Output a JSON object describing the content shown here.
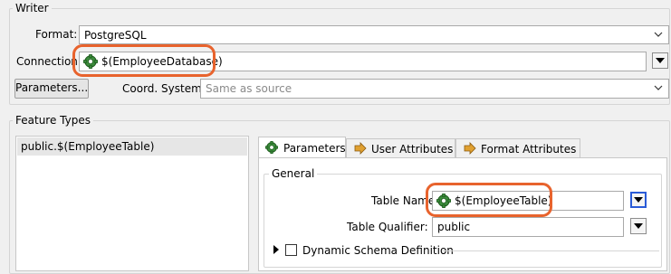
{
  "writer": {
    "group_title": "Writer",
    "format_label": "Format:",
    "format_value": "PostgreSQL",
    "connection_label": "Connection:",
    "connection_value": "$(EmployeeDatabase)",
    "parameters_button": "Parameters...",
    "coord_label": "Coord. System:",
    "coord_placeholder": "Same as source"
  },
  "feature_types": {
    "group_title": "Feature Types",
    "items": [
      "public.$(EmployeeTable)"
    ]
  },
  "tabs": [
    {
      "label": "Parameters",
      "icon": "gear-icon",
      "active": true
    },
    {
      "label": "User Attributes",
      "icon": "arrow-right-icon",
      "active": false
    },
    {
      "label": "Format Attributes",
      "icon": "arrow-right-icon",
      "active": false
    }
  ],
  "general": {
    "group_title": "General",
    "table_name_label": "Table Name",
    "table_name_value": "$(EmployeeTable)",
    "table_qualifier_label": "Table Qualifier:",
    "table_qualifier_value": "public",
    "dynamic_schema_label": "Dynamic Schema Definition",
    "dynamic_schema_checked": false
  },
  "colors": {
    "highlight": "#e8632d",
    "gear_green": "#3c8c3c"
  }
}
